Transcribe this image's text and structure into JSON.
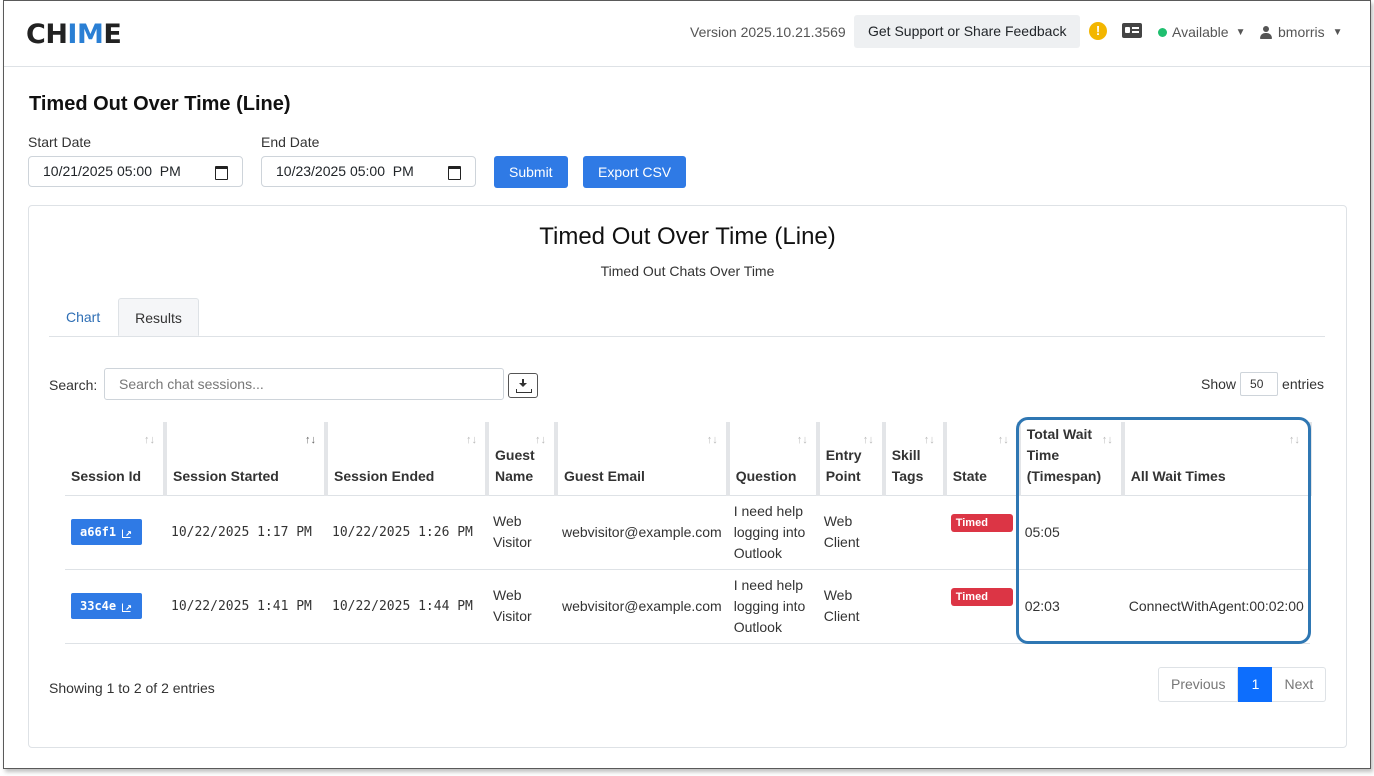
{
  "header": {
    "logo_prefix": "CH",
    "logo_highlight": "IM",
    "logo_suffix": "E",
    "version": "Version 2025.10.21.3569",
    "support_label": "Get Support or Share Feedback",
    "alert_glyph": "!",
    "status_label": "Available",
    "status_color": "#1fbf6f",
    "username": "bmorris"
  },
  "page": {
    "title": "Timed Out Over Time (Line)",
    "start_label": "Start Date",
    "start_value": "10/21/2025 05:00  PM",
    "end_label": "End Date",
    "end_value": "10/23/2025 05:00  PM",
    "submit_label": "Submit",
    "export_label": "Export CSV"
  },
  "report": {
    "title": "Timed Out Over Time (Line)",
    "subtitle": "Timed Out Chats Over Time",
    "tabs": [
      {
        "label": "Chart",
        "active": false
      },
      {
        "label": "Results",
        "active": true
      }
    ],
    "search_label": "Search:",
    "search_placeholder": "Search chat sessions...",
    "show_label": "Show",
    "show_value": "50",
    "entries_label": "entries",
    "columns": [
      "Session Id",
      "Session Started",
      "Session Ended",
      "Guest Name",
      "Guest Email",
      "Question",
      "Entry Point",
      "Skill Tags",
      "State",
      "Total Wait Time (Timespan)",
      "All Wait Times"
    ],
    "rows": [
      {
        "session_id": "a66f1",
        "started": "10/22/2025 1:17 PM",
        "ended": "10/22/2025 1:26 PM",
        "guest_name": "Web Visitor",
        "guest_email": "webvisitor@example.com",
        "question": "I need help logging into Outlook",
        "entry_point": "Web Client",
        "skill_tags": "",
        "state": "Timed Out",
        "total_wait": "05:05",
        "all_wait": ""
      },
      {
        "session_id": "33c4e",
        "started": "10/22/2025 1:41 PM",
        "ended": "10/22/2025 1:44 PM",
        "guest_name": "Web Visitor",
        "guest_email": "webvisitor@example.com",
        "question": "I need help logging into Outlook",
        "entry_point": "Web Client",
        "skill_tags": "",
        "state": "Timed Out",
        "total_wait": "02:03",
        "all_wait": "ConnectWithAgent:00:02:00"
      }
    ],
    "showing_text": "Showing 1 to 2 of 2 entries",
    "pager": {
      "previous": "Previous",
      "current": "1",
      "next": "Next"
    }
  }
}
